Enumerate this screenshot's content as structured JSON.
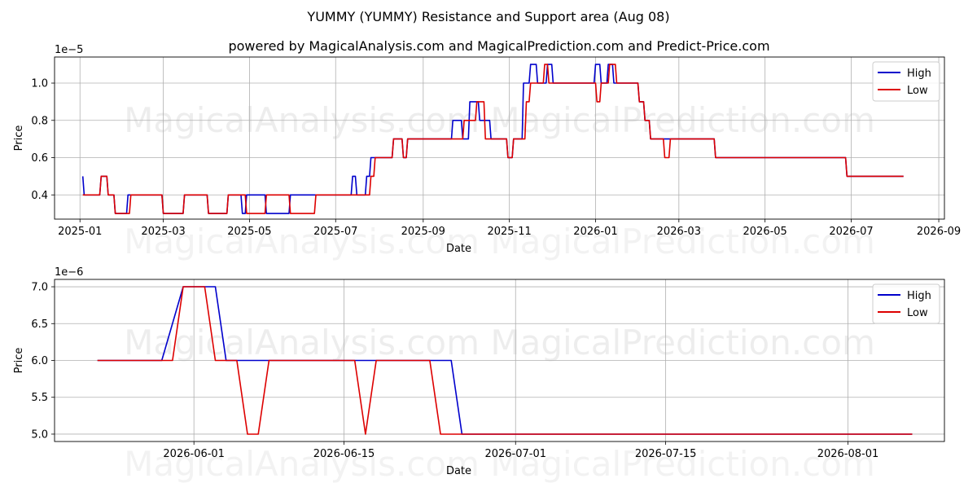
{
  "title": "YUMMY (YUMMY) Resistance and Support area (Aug 08)",
  "subtitle": "powered by MagicalAnalysis.com and MagicalPrediction.com and Predict-Price.com",
  "watermark": "MagicalAnalysis.com   MagicalPrediction.com",
  "colors": {
    "high": "#0000cc",
    "low": "#dd0000",
    "grid": "#b0b0b0"
  },
  "chart_data": [
    {
      "type": "line",
      "xlabel": "Date",
      "ylabel": "Price",
      "exponent_label": "1e−5",
      "xlim": [
        "2024-12-14",
        "2026-09-05"
      ],
      "ylim": [
        0.27,
        1.14
      ],
      "xticks": [
        "2025-01",
        "2025-03",
        "2025-05",
        "2025-07",
        "2025-09",
        "2025-11",
        "2026-01",
        "2026-03",
        "2026-05",
        "2026-07",
        "2026-09"
      ],
      "yticks": [
        "0.4",
        "0.6",
        "0.8",
        "1.0"
      ],
      "legend": "top-right",
      "grid": true,
      "series": [
        {
          "name": "High",
          "x": [
            "2025-01-03",
            "2025-01-04",
            "2025-01-15",
            "2025-01-16",
            "2025-01-20",
            "2025-01-21",
            "2025-01-25",
            "2025-01-26",
            "2025-02-03",
            "2025-02-04",
            "2025-02-28",
            "2025-03-01",
            "2025-03-15",
            "2025-03-16",
            "2025-04-01",
            "2025-04-02",
            "2025-04-15",
            "2025-04-16",
            "2025-04-25",
            "2025-04-26",
            "2025-04-28",
            "2025-04-29",
            "2025-05-12",
            "2025-05-13",
            "2025-05-29",
            "2025-05-30",
            "2025-06-15",
            "2025-06-16",
            "2025-07-12",
            "2025-07-13",
            "2025-07-15",
            "2025-07-16",
            "2025-07-22",
            "2025-07-23",
            "2025-07-25",
            "2025-07-26",
            "2025-08-10",
            "2025-08-11",
            "2025-08-17",
            "2025-08-18",
            "2025-08-20",
            "2025-08-21",
            "2025-09-21",
            "2025-09-22",
            "2025-09-28",
            "2025-09-29",
            "2025-10-03",
            "2025-10-04",
            "2025-10-10",
            "2025-10-11",
            "2025-10-18",
            "2025-10-19",
            "2025-10-30",
            "2025-10-31",
            "2025-11-03",
            "2025-11-04",
            "2025-11-10",
            "2025-11-11",
            "2025-11-15",
            "2025-11-16",
            "2025-11-20",
            "2025-11-21",
            "2025-11-27",
            "2025-11-28",
            "2025-12-01",
            "2025-12-02",
            "2025-12-31",
            "2026-01-01",
            "2026-01-04",
            "2026-01-05",
            "2026-01-09",
            "2026-01-10",
            "2026-01-13",
            "2026-01-14",
            "2026-01-31",
            "2026-02-01",
            "2026-02-04",
            "2026-02-05",
            "2026-02-08",
            "2026-02-09",
            "2026-03-26",
            "2026-03-27",
            "2026-06-27",
            "2026-06-28",
            "2026-08-07"
          ],
          "values": [
            0.5,
            0.4,
            0.4,
            0.5,
            0.5,
            0.4,
            0.4,
            0.3,
            0.3,
            0.4,
            0.4,
            0.3,
            0.3,
            0.4,
            0.4,
            0.3,
            0.3,
            0.4,
            0.4,
            0.3,
            0.3,
            0.4,
            0.4,
            0.3,
            0.3,
            0.4,
            0.4,
            0.4,
            0.4,
            0.5,
            0.5,
            0.4,
            0.4,
            0.5,
            0.5,
            0.6,
            0.6,
            0.7,
            0.7,
            0.6,
            0.6,
            0.7,
            0.7,
            0.8,
            0.8,
            0.7,
            0.7,
            0.9,
            0.9,
            0.8,
            0.8,
            0.7,
            0.7,
            0.6,
            0.6,
            0.7,
            0.7,
            1.0,
            1.0,
            1.1,
            1.1,
            1.0,
            1.0,
            1.1,
            1.1,
            1.0,
            1.0,
            1.1,
            1.1,
            1.0,
            1.0,
            1.1,
            1.1,
            1.0,
            1.0,
            0.9,
            0.9,
            0.8,
            0.8,
            0.7,
            0.7,
            0.6,
            0.6,
            0.5,
            0.5
          ]
        },
        {
          "name": "Low",
          "x": [
            "2025-01-03",
            "2025-01-15",
            "2025-01-16",
            "2025-01-20",
            "2025-01-21",
            "2025-01-25",
            "2025-01-26",
            "2025-02-05",
            "2025-02-06",
            "2025-02-28",
            "2025-03-01",
            "2025-03-15",
            "2025-03-16",
            "2025-04-01",
            "2025-04-02",
            "2025-04-15",
            "2025-04-16",
            "2025-04-28",
            "2025-04-29",
            "2025-05-12",
            "2025-05-13",
            "2025-05-29",
            "2025-05-30",
            "2025-06-16",
            "2025-06-17",
            "2025-07-25",
            "2025-07-26",
            "2025-07-28",
            "2025-07-29",
            "2025-08-10",
            "2025-08-11",
            "2025-08-17",
            "2025-08-18",
            "2025-08-20",
            "2025-08-21",
            "2025-09-29",
            "2025-09-30",
            "2025-10-08",
            "2025-10-09",
            "2025-10-14",
            "2025-10-15",
            "2025-10-30",
            "2025-10-31",
            "2025-11-03",
            "2025-11-04",
            "2025-11-12",
            "2025-11-13",
            "2025-11-15",
            "2025-11-16",
            "2025-11-25",
            "2025-11-26",
            "2025-11-28",
            "2025-11-29",
            "2025-12-01",
            "2025-12-02",
            "2026-01-01",
            "2026-01-02",
            "2026-01-04",
            "2026-01-05",
            "2026-01-10",
            "2026-01-11",
            "2026-01-15",
            "2026-01-16",
            "2026-01-31",
            "2026-02-01",
            "2026-02-04",
            "2026-02-05",
            "2026-02-08",
            "2026-02-09",
            "2026-02-18",
            "2026-02-19",
            "2026-02-22",
            "2026-02-23",
            "2026-03-26",
            "2026-03-27",
            "2026-06-01",
            "2026-06-02",
            "2026-06-05",
            "2026-06-06",
            "2026-06-27",
            "2026-06-28",
            "2026-08-07"
          ],
          "values": [
            0.4,
            0.4,
            0.5,
            0.5,
            0.4,
            0.4,
            0.3,
            0.3,
            0.4,
            0.4,
            0.3,
            0.3,
            0.4,
            0.4,
            0.3,
            0.3,
            0.4,
            0.4,
            0.3,
            0.3,
            0.4,
            0.4,
            0.3,
            0.3,
            0.4,
            0.4,
            0.5,
            0.5,
            0.6,
            0.6,
            0.7,
            0.7,
            0.6,
            0.6,
            0.7,
            0.7,
            0.8,
            0.8,
            0.9,
            0.9,
            0.7,
            0.7,
            0.6,
            0.6,
            0.7,
            0.7,
            0.9,
            0.9,
            1.0,
            1.0,
            1.1,
            1.1,
            1.0,
            1.0,
            1.0,
            1.0,
            0.9,
            0.9,
            1.0,
            1.0,
            1.1,
            1.1,
            1.0,
            1.0,
            0.9,
            0.9,
            0.8,
            0.8,
            0.7,
            0.7,
            0.6,
            0.6,
            0.7,
            0.7,
            0.6,
            0.6,
            0.6,
            0.6,
            0.6,
            0.6,
            0.5,
            0.5
          ]
        }
      ]
    },
    {
      "type": "line",
      "xlabel": "Date",
      "ylabel": "Price",
      "exponent_label": "1e−6",
      "xlim": [
        "2026-05-19",
        "2026-08-10"
      ],
      "ylim": [
        4.9,
        7.1
      ],
      "xticks": [
        "2026-06-01",
        "2026-06-15",
        "2026-07-01",
        "2026-07-15",
        "2026-08-01"
      ],
      "yticks": [
        "5.0",
        "5.5",
        "6.0",
        "6.5",
        "7.0"
      ],
      "legend": "top-right",
      "grid": true,
      "series": [
        {
          "name": "High",
          "x": [
            "2026-05-23",
            "2026-05-29",
            "2026-05-31",
            "2026-06-03",
            "2026-06-04",
            "2026-06-20",
            "2026-06-24",
            "2026-06-25",
            "2026-06-26",
            "2026-08-07"
          ],
          "values": [
            6.0,
            6.0,
            7.0,
            7.0,
            6.0,
            6.0,
            6.0,
            6.0,
            5.0,
            5.0
          ]
        },
        {
          "name": "Low",
          "x": [
            "2026-05-23",
            "2026-05-30",
            "2026-05-31",
            "2026-06-02",
            "2026-06-03",
            "2026-06-05",
            "2026-06-06",
            "2026-06-07",
            "2026-06-08",
            "2026-06-16",
            "2026-06-17",
            "2026-06-18",
            "2026-06-23",
            "2026-06-24",
            "2026-08-07"
          ],
          "values": [
            6.0,
            6.0,
            7.0,
            7.0,
            6.0,
            6.0,
            5.0,
            5.0,
            6.0,
            6.0,
            5.0,
            6.0,
            6.0,
            5.0,
            5.0
          ]
        }
      ]
    }
  ]
}
